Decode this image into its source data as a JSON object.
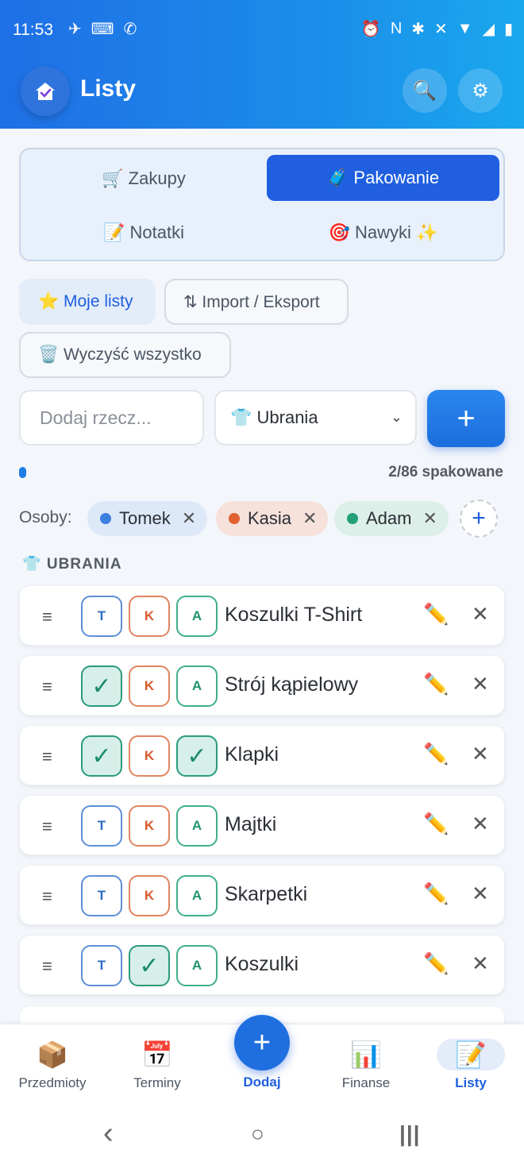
{
  "status_bar": {
    "time": "11:53",
    "left_icons": [
      "✈",
      "⌨",
      "✆"
    ],
    "right_icons": [
      "⏰",
      "N",
      "✱",
      "✕",
      "▼",
      "◢",
      "▮"
    ]
  },
  "header": {
    "title": "Listy"
  },
  "segments": [
    {
      "label": "🛒 Zakupy",
      "active": false
    },
    {
      "label": "🧳 Pakowanie",
      "active": true
    },
    {
      "label": "📝 Notatki",
      "active": false
    },
    {
      "label": "🎯 Nawyki ✨",
      "active": false
    }
  ],
  "chips": {
    "my_lists": "⭐ Moje listy",
    "import_export": "⇅ Import / Eksport",
    "clear_all": "🗑️ Wyczyść wszystko"
  },
  "add_form": {
    "placeholder": "Dodaj rzecz...",
    "category": "👕 Ubrania",
    "add_label": "+"
  },
  "progress": {
    "text": "2/86 spakowane",
    "fraction": 0.023
  },
  "persons": {
    "label": "Osoby:",
    "list": [
      {
        "name": "Tomek",
        "color": "#3b7fe0",
        "bg": "#dde8f8"
      },
      {
        "name": "Kasia",
        "color": "#e0602f",
        "bg": "#f6e1db"
      },
      {
        "name": "Adam",
        "color": "#23a07a",
        "bg": "#dcefe8"
      }
    ]
  },
  "section": {
    "title": "👕 UBRANIA"
  },
  "items": [
    {
      "name": "Koszulki T-Shirt",
      "t": "T",
      "k": "K",
      "a": "A"
    },
    {
      "name": "Strój kąpielowy",
      "t": "✓",
      "k": "K",
      "a": "A"
    },
    {
      "name": "Klapki",
      "t": "✓",
      "k": "K",
      "a": "✓"
    },
    {
      "name": "Majtki",
      "t": "T",
      "k": "K",
      "a": "A"
    },
    {
      "name": "Skarpetki",
      "t": "T",
      "k": "K",
      "a": "A"
    },
    {
      "name": "Koszulki",
      "t": "T",
      "k": "✓",
      "a": "A"
    }
  ],
  "bottom_nav": {
    "items": [
      {
        "icon": "📦",
        "label": "Przedmioty"
      },
      {
        "icon": "📅",
        "label": "Terminy"
      },
      {
        "icon": "+",
        "label": "Dodaj"
      },
      {
        "icon": "📊",
        "label": "Finanse"
      },
      {
        "icon": "📝",
        "label": "Listy"
      }
    ]
  },
  "icons": {
    "drag": "≡",
    "edit": "✏️",
    "delete": "✕",
    "search": "🔍",
    "settings": "⚙",
    "back": "‹",
    "home": "○",
    "recents": "|||"
  }
}
